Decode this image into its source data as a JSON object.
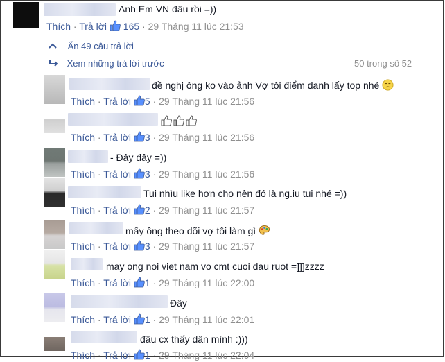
{
  "main_comment": {
    "text": "Anh Em VN đâu rồi =))",
    "like_label": "Thích",
    "reply_label": "Trả lời",
    "likes": "165",
    "timestamp": "29 Tháng 11 lúc 21:53"
  },
  "thread": {
    "hide_label": "Ẩn 49 câu trả lời",
    "see_prev_label": "Xem những trả lời trước",
    "page_count": "50 trong số 52"
  },
  "replies": [
    {
      "text": "đề nghị ông ko vào ảnh Vợ tôi điểm danh lấy top nhé",
      "like_label": "Thích",
      "reply_label": "Trả lời",
      "likes": "5",
      "timestamp": "29 Tháng 11 lúc 21:56",
      "emoji": "unamused-face-icon"
    },
    {
      "text": "",
      "like_label": "Thích",
      "reply_label": "Trả lời",
      "likes": "3",
      "timestamp": "29 Tháng 11 lúc 21:56",
      "emoji": "thumbs-up-outline-icon"
    },
    {
      "text": "- Đây đây =))",
      "like_label": "Thích",
      "reply_label": "Trả lời",
      "likes": "3",
      "timestamp": "29 Tháng 11 lúc 21:56"
    },
    {
      "text": "Tui nhìu like hơn cho nên đó là ng.iu tui nhé =))",
      "like_label": "Thích",
      "reply_label": "Trả lời",
      "likes": "2",
      "timestamp": "29 Tháng 11 lúc 21:57"
    },
    {
      "text": "mấy ông theo dõi vợ tôi làm gì",
      "like_label": "Thích",
      "reply_label": "Trả lời",
      "likes": "3",
      "timestamp": "29 Tháng 11 lúc 21:57",
      "emoji": "artist-palette-icon"
    },
    {
      "text": "may ong noi viet nam vo cmt cuoi dau ruot =]]]zzzz",
      "like_label": "Thích",
      "reply_label": "Trả lời",
      "likes": "1",
      "timestamp": "29 Tháng 11 lúc 22:00"
    },
    {
      "text": "Đây",
      "like_label": "Thích",
      "reply_label": "Trả lời",
      "likes": "1",
      "timestamp": "29 Tháng 11 lúc 22:01"
    },
    {
      "text": "đâu cx thấy dân mình :)))",
      "like_label": "Thích",
      "reply_label": "Trả lời",
      "likes": "1",
      "timestamp": "29 Tháng 11 lúc 22:04"
    }
  ],
  "colors": {
    "link": "#3b5998",
    "meta": "#8f8f8f",
    "text": "#141823"
  }
}
